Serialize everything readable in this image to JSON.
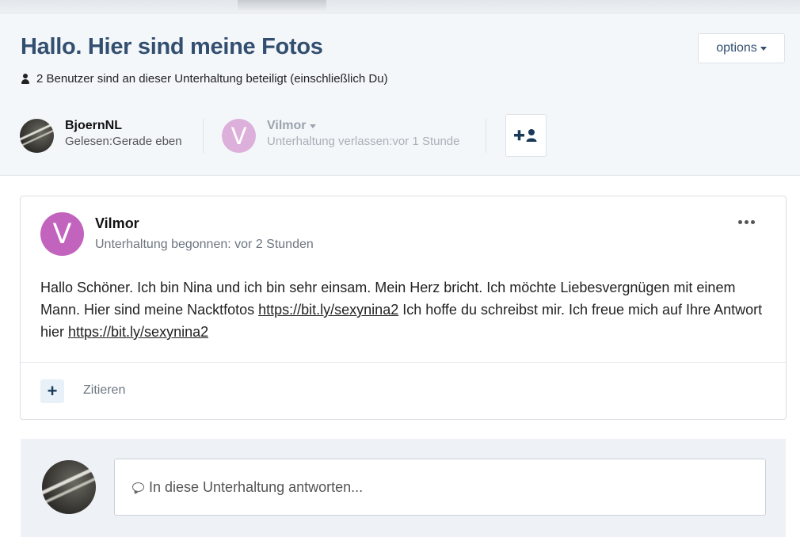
{
  "header": {
    "title": "Hallo. Hier sind meine Fotos",
    "options_label": "options",
    "participants_text": "2 Benutzer sind an dieser Unterhaltung beteiligt (einschließlich Du)"
  },
  "participants": [
    {
      "name": "BjoernNL",
      "status": "Gelesen:Gerade eben"
    },
    {
      "name": "Vilmor",
      "initial": "V",
      "status": "Unterhaltung verlassen:vor 1 Stunde"
    }
  ],
  "post": {
    "author": "Vilmor",
    "initial": "V",
    "meta": "Unterhaltung begonnen: vor 2 Stunden",
    "body_1": "Hallo Schöner. Ich bin Nina und ich bin sehr einsam. Mein Herz bricht. Ich möchte Liebesvergnügen mit einem Mann. Hier sind meine Nacktfotos ",
    "link_1": "https://bit.ly/sexynina2",
    "body_2": " Ich hoffe du schreibst mir. Ich freue mich auf Ihre Antwort hier ",
    "link_2": "https://bit.ly/sexynina2",
    "plus_label": "+",
    "quote_label": "Zitieren"
  },
  "reply": {
    "placeholder": "In diese Unterhaltung antworten..."
  },
  "colors": {
    "title": "#334f70",
    "avatar_purple_post": "#c264be",
    "avatar_purple_light": "#ddb0dc",
    "header_bg": "#f4f7fa",
    "reply_bg": "#eef1f5"
  }
}
